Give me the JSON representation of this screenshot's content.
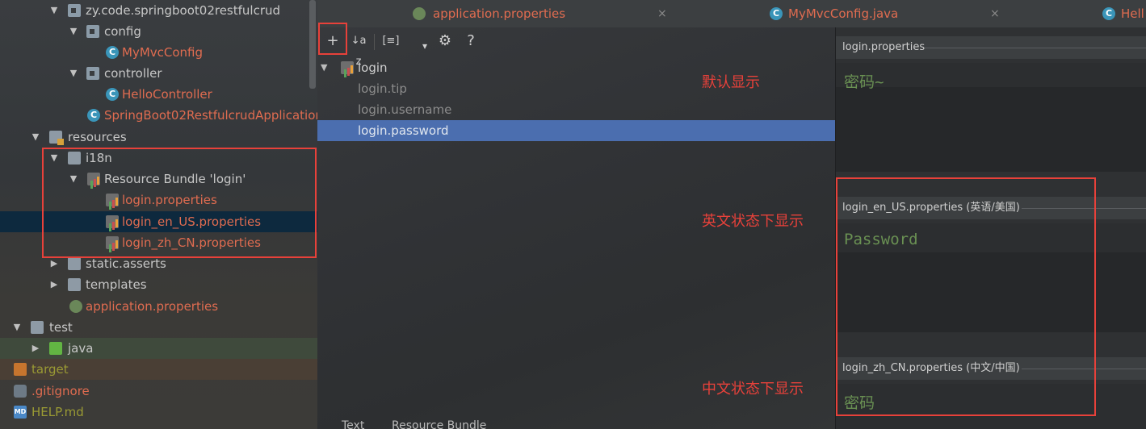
{
  "tree": {
    "items": [
      {
        "label": "zy.code.springboot02restfulcrud",
        "arrow": "▼"
      },
      {
        "label": "config",
        "arrow": "▼"
      },
      {
        "label": "MyMvcConfig",
        "icon_letter": "C"
      },
      {
        "label": "controller",
        "arrow": "▼"
      },
      {
        "label": "HelloController",
        "icon_letter": "C"
      },
      {
        "label": "SpringBoot02RestfulcrudApplication",
        "icon_letter": "C"
      },
      {
        "label": "resources",
        "arrow": "▼"
      },
      {
        "label": "i18n",
        "arrow": "▼"
      },
      {
        "label": "Resource Bundle 'login'",
        "arrow": "▼"
      },
      {
        "label": "login.properties"
      },
      {
        "label": "login_en_US.properties"
      },
      {
        "label": "login_zh_CN.properties"
      },
      {
        "label": "static.asserts",
        "arrow": "▶"
      },
      {
        "label": "templates",
        "arrow": "▶"
      },
      {
        "label": "application.properties"
      },
      {
        "label": "test",
        "arrow": "▼"
      },
      {
        "label": "java",
        "arrow": "▶"
      },
      {
        "label": "target"
      },
      {
        "label": ".gitignore"
      },
      {
        "label": "HELP.md",
        "icon_letter": "MD"
      }
    ]
  },
  "tabs": [
    {
      "label": "application.properties",
      "close": "×"
    },
    {
      "label": "MyMvcConfig.java",
      "close": "×",
      "icon_letter": "C"
    },
    {
      "label": "Hell",
      "icon_letter": "C"
    }
  ],
  "toolbar": {
    "add": "+",
    "sort": "↓a z",
    "group": "[≡]",
    "dropdown": "▾",
    "settings": "⚙",
    "help": "?"
  },
  "bundle": {
    "root": {
      "label": "login",
      "arrow": "▼"
    },
    "keys": [
      "login.tip",
      "login.username",
      "login.password"
    ]
  },
  "annotations": {
    "default": "默认显示",
    "english": "英文状态下显示",
    "chinese": "中文状态下显示"
  },
  "values": [
    {
      "file": "login.properties",
      "value": "密码~"
    },
    {
      "file": "login_en_US.properties (英语/美国)",
      "value": "Password"
    },
    {
      "file": "login_zh_CN.properties (中文/中国)",
      "value": "密码"
    }
  ],
  "bottom_tabs": [
    "Text",
    "Resource Bundle"
  ],
  "colors": {
    "accent_red": "#e8413a",
    "file_red": "#e06c50",
    "selection": "#4b6eaf",
    "value_green": "#6a9153"
  }
}
